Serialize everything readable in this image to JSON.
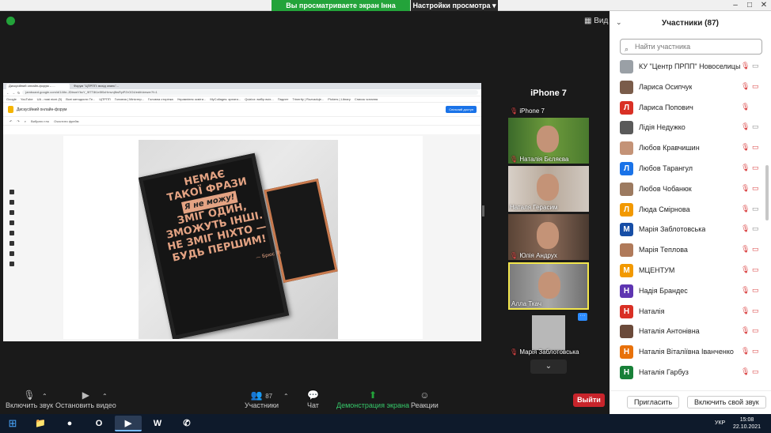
{
  "zoom_bar": {
    "banner": "Вы просматриваете экран Інна Терлецька",
    "view_options": "Настройки просмотра ▾",
    "view_button": "Вид",
    "window_controls": [
      "–",
      "□",
      "✕"
    ]
  },
  "browser": {
    "tabs": [
      "Дискусійний онлайн-форум – ...",
      "Форум \"ЦПРПП: вихід знань\"..."
    ],
    "address": "jamboard.google.com/d/14thr-JDbsmYbcY_9f7T8t1e5f0cHmvnjfbsRyiPZrOO4/edit/viewer?f=1",
    "bookmarks": [
      "Google",
      "YouTube",
      "UA - нові пісні (5)",
      "Всеі методисти Те...",
      "ЦПРПП",
      "Головна | Міністер...",
      "Головна сторінка",
      "Управління освіти...",
      "MyCollages: креати...",
      "Quizizz: вибір всіх...",
      "Падлет",
      "Trinerity | Rozvaduje...",
      "Pickers | Library",
      "Список читання"
    ],
    "jamboard": {
      "title": "Дискусійний онлайн-форум",
      "share_label": "Спільний доступ",
      "tools": [
        "Вибрати тло",
        "Очистити фрейм"
      ],
      "quote_lines": [
        "НЕМАЄ",
        "ТАКОЇ ФРАЗИ"
      ],
      "quote_highlight": "Я не можу!",
      "quote_rest": [
        "ЗМІГ ОДИН,",
        "ЗМОЖУТЬ ІНШІ.",
        "НЕ ЗМІГ НІХТО —",
        "БУДЬ ПЕРШИМ!"
      ],
      "quote_sign": "— Брюс Лі"
    }
  },
  "gallery": {
    "tiles": [
      {
        "name": "iPhone 7",
        "big": "iPhone 7"
      },
      {
        "name": "Наталія Бєляєва"
      },
      {
        "name": "Наталя Герасим"
      },
      {
        "name": "Юлія Андрух"
      },
      {
        "name": "Алла Ткач"
      },
      {
        "name": "Марія Заблотовська"
      }
    ],
    "more_label": "···",
    "down_icon": "⌄"
  },
  "toolbar": {
    "mute": "Включить звук",
    "video": "Остановить видео",
    "participants": "Участники",
    "participants_count": "87",
    "chat": "Чат",
    "share": "Демонстрация экрана",
    "reactions": "Реакции",
    "leave": "Выйти"
  },
  "panel": {
    "title": "Участники (87)",
    "search_placeholder": "Найти участника",
    "participants": [
      {
        "name": "КУ \"Центр ПРПП\" Новоселицько...",
        "initial": "",
        "color": "#9aa0a6",
        "cam_off": false
      },
      {
        "name": "Лариса Осипчук",
        "initial": "",
        "color": "#7a5c4a",
        "cam_off": true
      },
      {
        "name": "Лариса Попович",
        "initial": "Л",
        "color": "#d93025",
        "cam_off": null
      },
      {
        "name": "Лідія Недужко",
        "initial": "",
        "color": "#5a5a5a",
        "cam_off": false
      },
      {
        "name": "Любов Кравчишин",
        "initial": "",
        "color": "#c49377",
        "cam_off": true
      },
      {
        "name": "Любов Тарангул",
        "initial": "Л",
        "color": "#1a73e8",
        "cam_off": true
      },
      {
        "name": "Любов Чобанюк",
        "initial": "",
        "color": "#9c7a60",
        "cam_off": true
      },
      {
        "name": "Люда Смірнова",
        "initial": "Л",
        "color": "#f29900",
        "cam_off": false
      },
      {
        "name": "Марія Заблотовська",
        "initial": "М",
        "color": "#174ea6",
        "cam_off": false
      },
      {
        "name": "Марія Теплова",
        "initial": "",
        "color": "#b07a5a",
        "cam_off": true
      },
      {
        "name": "МЦЕНТУМ",
        "initial": "М",
        "color": "#f29900",
        "cam_off": true
      },
      {
        "name": "Надія Брандес",
        "initial": "Н",
        "color": "#5e35b1",
        "cam_off": true
      },
      {
        "name": "Наталія",
        "initial": "Н",
        "color": "#d93025",
        "cam_off": true
      },
      {
        "name": "Наталія Антонівна",
        "initial": "",
        "color": "#6b4a3a",
        "cam_off": true
      },
      {
        "name": "Наталія Віталіївна Іванченко",
        "initial": "Н",
        "color": "#e8710a",
        "cam_off": true
      },
      {
        "name": "Наталія Гарбуз",
        "initial": "Н",
        "color": "#188038",
        "cam_off": true
      }
    ],
    "invite": "Пригласить",
    "unmute_me": "Включить свой звук"
  },
  "taskbar": {
    "apps": [
      {
        "icon": "📁",
        "name": "explorer"
      },
      {
        "icon": "●",
        "name": "chrome"
      },
      {
        "icon": "O",
        "name": "opera"
      },
      {
        "icon": "▶",
        "name": "zoom"
      },
      {
        "icon": "W",
        "name": "word"
      },
      {
        "icon": "✆",
        "name": "viber"
      }
    ],
    "lang": "УКР",
    "time": "15:08",
    "date": "22.10.2021"
  },
  "colors": {
    "share_green": "#23a33a",
    "leave_red": "#c8242b",
    "active_speaker_border": "#f2e64c",
    "accent_blue": "#2d8cff"
  }
}
